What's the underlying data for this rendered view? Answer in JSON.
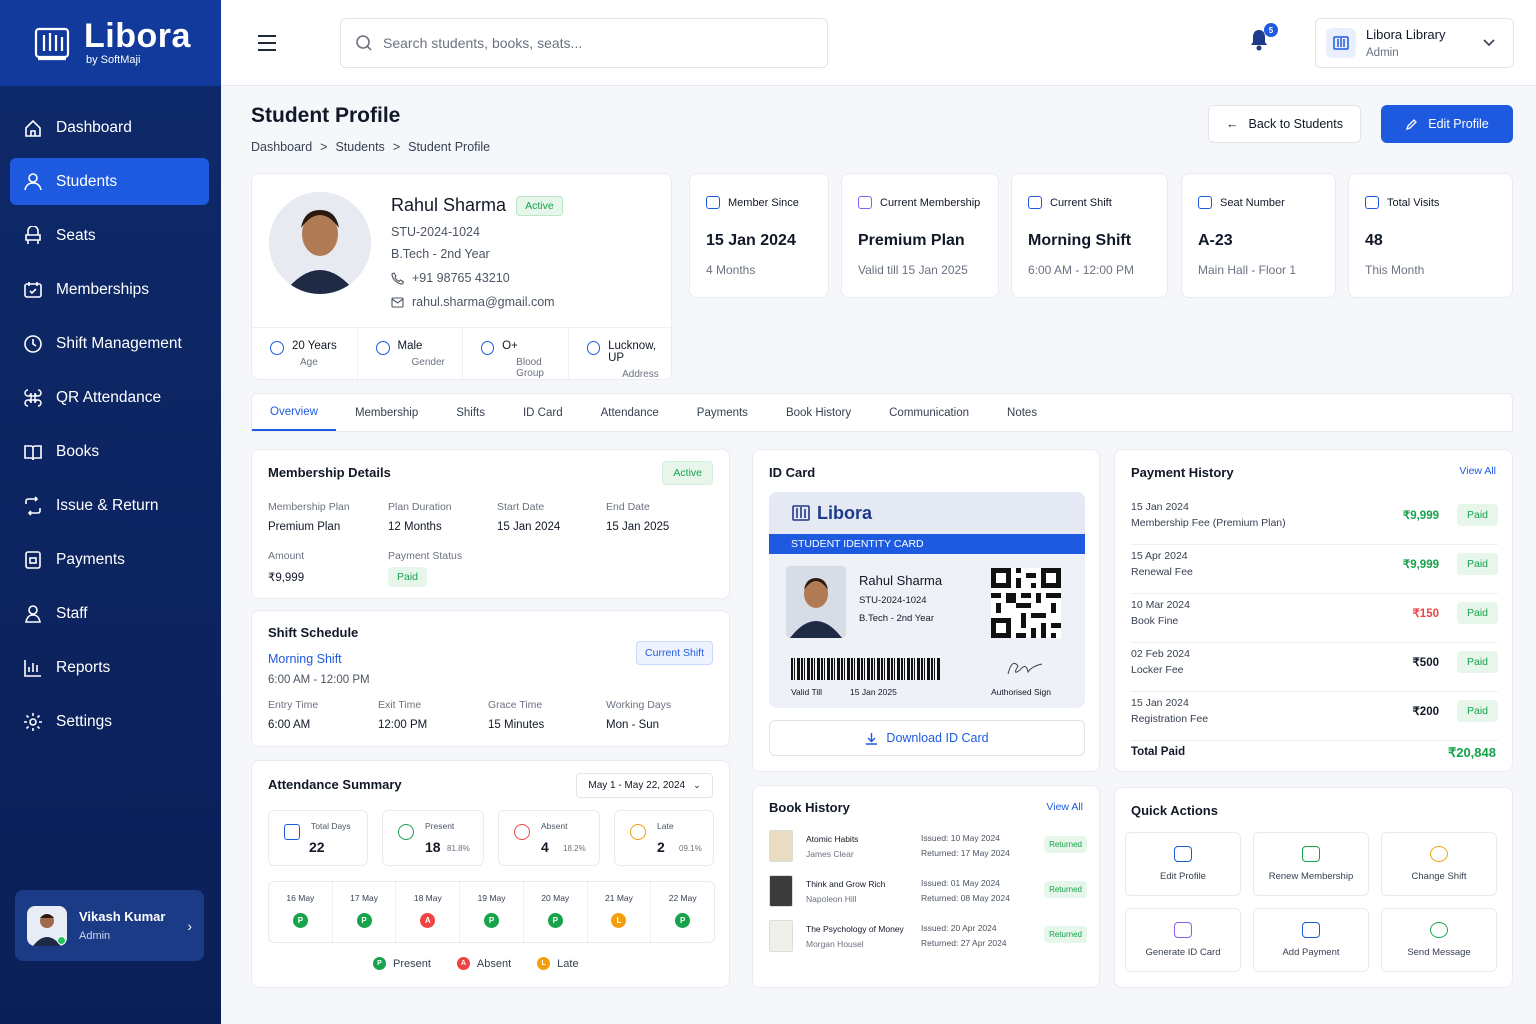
{
  "brand": {
    "name": "Libora",
    "sub": "by SoftMaji"
  },
  "nav": [
    {
      "label": "Dashboard",
      "icon": "home-icon"
    },
    {
      "label": "Students",
      "icon": "students-icon",
      "active": true
    },
    {
      "label": "Seats",
      "icon": "seat-icon"
    },
    {
      "label": "Memberships",
      "icon": "membership-icon"
    },
    {
      "label": "Shift Management",
      "icon": "clock-icon"
    },
    {
      "label": "QR Attendance",
      "icon": "qr-icon"
    },
    {
      "label": "Books",
      "icon": "book-icon"
    },
    {
      "label": "Issue & Return",
      "icon": "exchange-icon"
    },
    {
      "label": "Payments",
      "icon": "wallet-icon"
    },
    {
      "label": "Staff",
      "icon": "staff-icon"
    },
    {
      "label": "Reports",
      "icon": "chart-icon"
    },
    {
      "label": "Settings",
      "icon": "gear-icon"
    }
  ],
  "user": {
    "name": "Vikash Kumar",
    "role": "Admin"
  },
  "search": {
    "placeholder": "Search students, books, seats..."
  },
  "notifications": {
    "count": "5"
  },
  "library": {
    "name": "Libora Library",
    "role": "Admin"
  },
  "page": {
    "title": "Student Profile",
    "crumbs": [
      "Dashboard",
      "Students",
      "Student Profile"
    ],
    "back": "Back to Students",
    "edit": "Edit Profile"
  },
  "student": {
    "name": "Rahul Sharma",
    "status": "Active",
    "id": "STU-2024-1024",
    "course": "B.Tech - 2nd Year",
    "phone": "+91 98765 43210",
    "email": "rahul.sharma@gmail.com",
    "facts": [
      {
        "value": "20 Years",
        "label": "Age"
      },
      {
        "value": "Male",
        "label": "Gender"
      },
      {
        "value": "O+",
        "label": "Blood Group"
      },
      {
        "value": "Lucknow, UP",
        "label": "Address"
      }
    ]
  },
  "stats": [
    {
      "title": "Member Since",
      "value": "15 Jan 2024",
      "sub": "4 Months"
    },
    {
      "title": "Current Membership",
      "value": "Premium Plan",
      "sub": "Valid till 15 Jan 2025"
    },
    {
      "title": "Current Shift",
      "value": "Morning Shift",
      "sub": "6:00 AM - 12:00 PM"
    },
    {
      "title": "Seat Number",
      "value": "A-23",
      "sub": "Main Hall - Floor 1"
    },
    {
      "title": "Total Visits",
      "value": "48",
      "sub": "This Month"
    }
  ],
  "tabs": [
    "Overview",
    "Membership",
    "Shifts",
    "ID Card",
    "Attendance",
    "Payments",
    "Book History",
    "Communication",
    "Notes"
  ],
  "membership": {
    "title": "Membership Details",
    "status": "Active",
    "fields": [
      {
        "label": "Membership Plan",
        "value": "Premium Plan"
      },
      {
        "label": "Plan Duration",
        "value": "12 Months"
      },
      {
        "label": "Start Date",
        "value": "15 Jan 2024"
      },
      {
        "label": "End Date",
        "value": "15 Jan 2025"
      }
    ],
    "amount_label": "Amount",
    "amount": "₹9,999",
    "pay_status_label": "Payment Status",
    "pay_status": "Paid"
  },
  "shift": {
    "title": "Shift Schedule",
    "badge": "Current Shift",
    "name": "Morning Shift",
    "time": "6:00 AM - 12:00 PM",
    "fields": [
      {
        "label": "Entry Time",
        "value": "6:00 AM"
      },
      {
        "label": "Exit Time",
        "value": "12:00 PM"
      },
      {
        "label": "Grace Time",
        "value": "15 Minutes"
      },
      {
        "label": "Working Days",
        "value": "Mon - Sun"
      }
    ]
  },
  "attendance": {
    "title": "Attendance Summary",
    "range": "May 1 - May 22, 2024",
    "boxes": [
      {
        "label": "Total Days",
        "value": "22",
        "pct": ""
      },
      {
        "label": "Present",
        "value": "18",
        "pct": "81.8%"
      },
      {
        "label": "Absent",
        "value": "4",
        "pct": "18.2%"
      },
      {
        "label": "Late",
        "value": "2",
        "pct": "09.1%"
      }
    ],
    "days": [
      {
        "d": "16 May",
        "s": "P"
      },
      {
        "d": "17 May",
        "s": "P"
      },
      {
        "d": "18 May",
        "s": "A"
      },
      {
        "d": "19 May",
        "s": "P"
      },
      {
        "d": "20 May",
        "s": "P"
      },
      {
        "d": "21 May",
        "s": "L"
      },
      {
        "d": "22 May",
        "s": "P"
      }
    ],
    "legend": [
      "Present",
      "Absent",
      "Late"
    ]
  },
  "idcard": {
    "title": "ID Card",
    "brand": "Libora",
    "strip": "STUDENT IDENTITY CARD",
    "name": "Rahul Sharma",
    "id": "STU-2024-1024",
    "course": "B.Tech - 2nd Year",
    "valid_label": "Valid Till",
    "valid": "15 Jan 2025",
    "sign": "Authorised Sign",
    "download": "Download ID Card"
  },
  "books": {
    "title": "Book History",
    "view": "View All",
    "items": [
      {
        "title": "Atomic Habits",
        "author": "James Clear",
        "issued": "Issued: 10 May 2024",
        "returned": "Returned: 17 May 2024",
        "status": "Returned",
        "color": "#e9dcc0"
      },
      {
        "title": "Think and Grow Rich",
        "author": "Napoleon Hill",
        "issued": "Issued: 01 May 2024",
        "returned": "Returned: 08 May 2024",
        "status": "Returned",
        "color": "#3b3b3b"
      },
      {
        "title": "The Psychology of Money",
        "author": "Morgan Housel",
        "issued": "Issued: 20 Apr 2024",
        "returned": "Returned: 27 Apr 2024",
        "status": "Returned",
        "color": "#f0efe9"
      }
    ]
  },
  "payments": {
    "title": "Payment History",
    "view": "View All",
    "items": [
      {
        "date": "15 Jan 2024",
        "desc": "Membership Fee (Premium Plan)",
        "amount": "₹9,999",
        "status": "Paid",
        "color": "#16a34a"
      },
      {
        "date": "15 Apr 2024",
        "desc": "Renewal Fee",
        "amount": "₹9,999",
        "status": "Paid",
        "color": "#16a34a"
      },
      {
        "date": "10 Mar 2024",
        "desc": "Book Fine",
        "amount": "₹150",
        "status": "Paid",
        "color": "#ef4444"
      },
      {
        "date": "02 Feb 2024",
        "desc": "Locker Fee",
        "amount": "₹500",
        "status": "Paid",
        "color": "#111827"
      },
      {
        "date": "15 Jan 2024",
        "desc": "Registration Fee",
        "amount": "₹200",
        "status": "Paid",
        "color": "#111827"
      }
    ],
    "total_label": "Total Paid",
    "total": "₹20,848"
  },
  "quick": {
    "title": "Quick Actions",
    "items": [
      "Edit Profile",
      "Renew Membership",
      "Change Shift",
      "Generate ID Card",
      "Add Payment",
      "Send Message"
    ]
  },
  "colors": {
    "primary": "#1e5ae0",
    "sidebar": "#0e2a6b",
    "success": "#16a34a",
    "danger": "#ef4444",
    "warning": "#f59e0b"
  }
}
